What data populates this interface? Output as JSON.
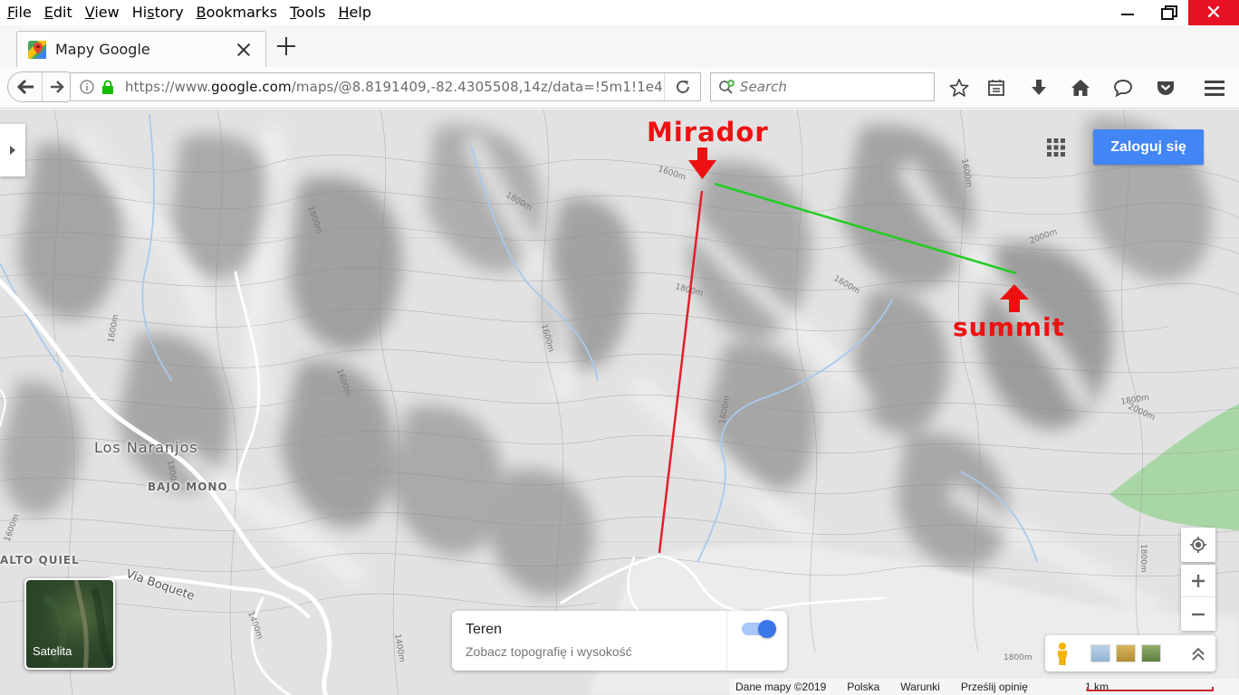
{
  "menubar": {
    "items": [
      {
        "mnemonic": "F",
        "rest": "ile"
      },
      {
        "mnemonic": "E",
        "rest": "dit"
      },
      {
        "mnemonic": "V",
        "rest": "iew"
      },
      {
        "mnemonic": "S",
        "rest": "History",
        "pre": "Hi",
        "post": "tory"
      },
      {
        "mnemonic": "B",
        "rest": "ookmarks"
      },
      {
        "mnemonic": "T",
        "rest": "ools"
      },
      {
        "mnemonic": "H",
        "rest": "elp"
      }
    ]
  },
  "window_controls": {
    "minimize": "minimize-icon",
    "restore": "restore-icon",
    "close": "✕"
  },
  "tab": {
    "title": "Mapy Google"
  },
  "urlbar": {
    "url_prefix": "https://www.",
    "url_domain": "google.com",
    "url_suffix": "/maps/@8.8191409,-82.4305508,14z/data=!5m1!1e4"
  },
  "search": {
    "placeholder": "Search"
  },
  "map": {
    "login_button": "Zaloguj się",
    "places": {
      "los_naranjos": "Los Naranjos",
      "bajo_mono": "BAJO MONO",
      "alto_quiel": "ALTO QUIEL",
      "via_boquete": "Via Boquete"
    },
    "annotations": {
      "mirador": "Mirador",
      "summit": "summit"
    },
    "contour_labels": [
      "1600m",
      "1800m",
      "1800m",
      "1600m",
      "1800m",
      "1600m",
      "1600m",
      "1600m",
      "2000m",
      "1600m",
      "1800m",
      "1800m",
      "2000m",
      "1800m",
      "1800m",
      "1600m",
      "1400m",
      "1600m",
      "1400m"
    ],
    "satellite_label": "Satelita",
    "terrain": {
      "title": "Teren",
      "description": "Zobacz topografię i wysokość",
      "enabled": true
    },
    "footer": {
      "data_credit": "Dane mapy ©2019",
      "country": "Polska",
      "terms": "Warunki",
      "feedback": "Prześlij opinię",
      "scale": "1 km"
    },
    "colors": {
      "annotation_red": "#ee1111",
      "green_line": "#22cc22",
      "login_blue": "#4285f4"
    }
  }
}
